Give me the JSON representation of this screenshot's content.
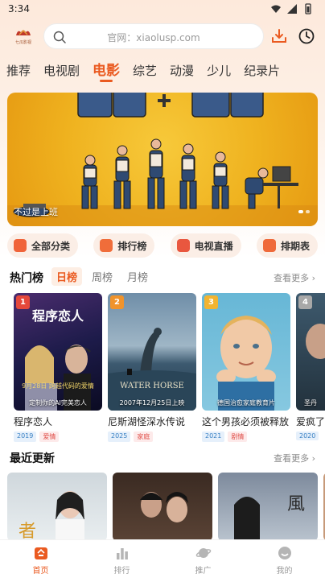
{
  "status_bar": {
    "time": "3:34"
  },
  "header": {
    "logo_text": "七瓜影视",
    "search_placeholder": "官网：xiaolusp.com"
  },
  "tabs": [
    {
      "label": "推荐",
      "active": false
    },
    {
      "label": "电视剧",
      "active": false
    },
    {
      "label": "电影",
      "active": true
    },
    {
      "label": "综艺",
      "active": false
    },
    {
      "label": "动漫",
      "active": false
    },
    {
      "label": "少儿",
      "active": false
    },
    {
      "label": "纪录片",
      "active": false
    }
  ],
  "banner": {
    "caption": "不过是上班",
    "page_count": 2,
    "active_index": 1
  },
  "quick_actions": [
    {
      "label": "全部分类",
      "icon": "play-icon",
      "color": "#f0643a"
    },
    {
      "label": "排行榜",
      "icon": "fire-icon",
      "color": "#f06d3a"
    },
    {
      "label": "电视直播",
      "icon": "tv-icon",
      "color": "#e9573f"
    },
    {
      "label": "排期表",
      "icon": "calendar-icon",
      "color": "#ef6a3b"
    }
  ],
  "hot": {
    "title": "热门榜",
    "rank_tabs": [
      {
        "label": "日榜",
        "active": true
      },
      {
        "label": "周榜",
        "active": false
      },
      {
        "label": "月榜",
        "active": false
      }
    ],
    "more": "查看更多 ›",
    "items": [
      {
        "rank": "1",
        "name": "程序恋人",
        "caption": "定制你的AI完美恋人",
        "year": "2019",
        "genre": "爱情",
        "badge_color": "#e5483b"
      },
      {
        "rank": "2",
        "name": "尼斯湖怪深水传说",
        "caption": "2007年12月25日上映",
        "year": "2025",
        "genre": "家庭",
        "badge_color": "#f0932b"
      },
      {
        "rank": "3",
        "name": "这个男孩必须被释放",
        "caption": "德国治愈家庭教育片",
        "year": "2021",
        "genre": "剧情",
        "badge_color": "#f2b431"
      },
      {
        "rank": "4",
        "name": "爱疯了",
        "caption": "圣丹",
        "year": "2020",
        "genre": "",
        "badge_color": "#a8a8a8"
      }
    ]
  },
  "recent": {
    "title": "最近更新",
    "more": "查看更多 ›"
  },
  "bottom_nav": [
    {
      "label": "首页",
      "icon": "home-icon",
      "active": true
    },
    {
      "label": "排行",
      "icon": "chart-icon",
      "active": false
    },
    {
      "label": "推广",
      "icon": "planet-icon",
      "active": false
    },
    {
      "label": "我的",
      "icon": "profile-icon",
      "active": false
    }
  ],
  "colors": {
    "accent": "#ea5a20"
  }
}
